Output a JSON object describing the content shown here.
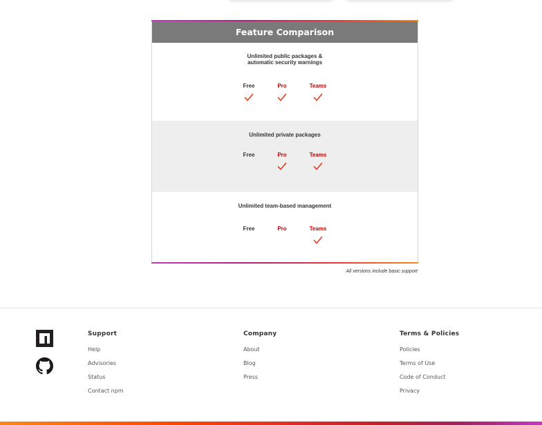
{
  "comparison": {
    "title": "Feature Comparison",
    "rows": [
      {
        "feature": "Unlimited public packages &\nautomatic security warnings",
        "plans": [
          {
            "label": "Free",
            "included": true
          },
          {
            "label": "Pro",
            "included": true
          },
          {
            "label": "Teams",
            "included": true
          }
        ]
      },
      {
        "feature": "Unlimited private packages",
        "plans": [
          {
            "label": "Free",
            "included": false
          },
          {
            "label": "Pro",
            "included": true
          },
          {
            "label": "Teams",
            "included": true
          }
        ]
      },
      {
        "feature": "Unlimited team-based management",
        "plans": [
          {
            "label": "Free",
            "included": false
          },
          {
            "label": "Pro",
            "included": false
          },
          {
            "label": "Teams",
            "included": true
          }
        ]
      }
    ],
    "footnote": "All versions include basic support",
    "colors": {
      "header_bg": "#7a7a7a",
      "check": "#e63a1f",
      "paid_label": "#cb0000"
    }
  },
  "footer": {
    "icons": [
      "npm-logo-icon",
      "github-icon"
    ],
    "columns": [
      {
        "heading": "Support",
        "links": [
          "Help",
          "Advisories",
          "Status",
          "Contact npm"
        ]
      },
      {
        "heading": "Company",
        "links": [
          "About",
          "Blog",
          "Press"
        ]
      },
      {
        "heading": "Terms & Policies",
        "links": [
          "Policies",
          "Terms of Use",
          "Code of Conduct",
          "Privacy"
        ]
      }
    ]
  }
}
